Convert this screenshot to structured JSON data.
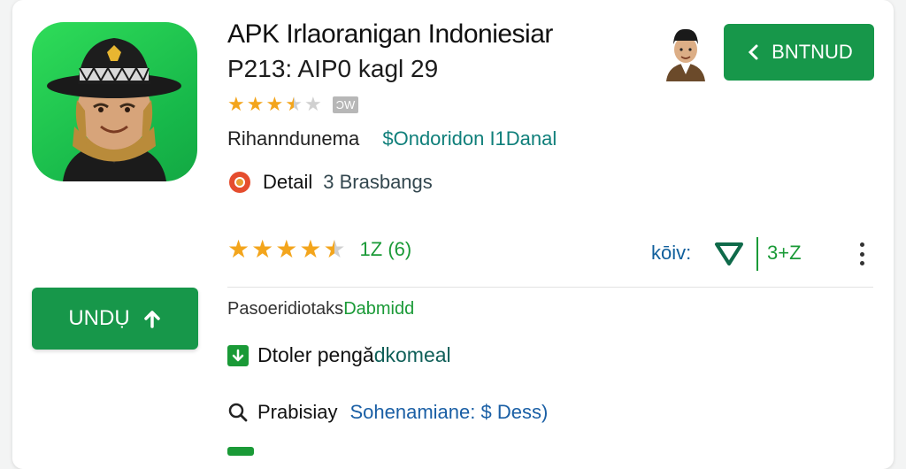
{
  "app": {
    "title": "APK Irlaoranigan Indoniesiar",
    "subtitle": "P213: AIP0 kagl 29",
    "rating_badge": "ƆW",
    "developer": "Rihanndunema",
    "developer_sub": "$Ondoridon I1Danal"
  },
  "detail": {
    "label": "Detail",
    "value": "3 Brasbangs"
  },
  "top_button": {
    "label": "BNTNUD"
  },
  "ratings": {
    "top_stars": 3.5,
    "stars": 4.5,
    "count": "1Z (6)",
    "kb_label": "kōiv:",
    "count2": "3+Z"
  },
  "download_button": {
    "label": "UNDỤ"
  },
  "info": {
    "line1_a": "Pasoeridiotaks",
    "line1_b": "Dabmidd",
    "line2_a": "Dtoler pengă",
    "line2_b": "dkomeal",
    "line3_a": "Prabisiay",
    "line3_b": "Sohenamiane: $ Dess)"
  },
  "colors": {
    "accent_green": "#17974a",
    "star": "#f3a51c",
    "link_blue": "#1a5fa5"
  },
  "icons": {
    "app": "police-officer-avatar",
    "detail": "chrome-like-icon",
    "shield": "shield-icon",
    "search": "search-icon",
    "download": "download-icon"
  }
}
